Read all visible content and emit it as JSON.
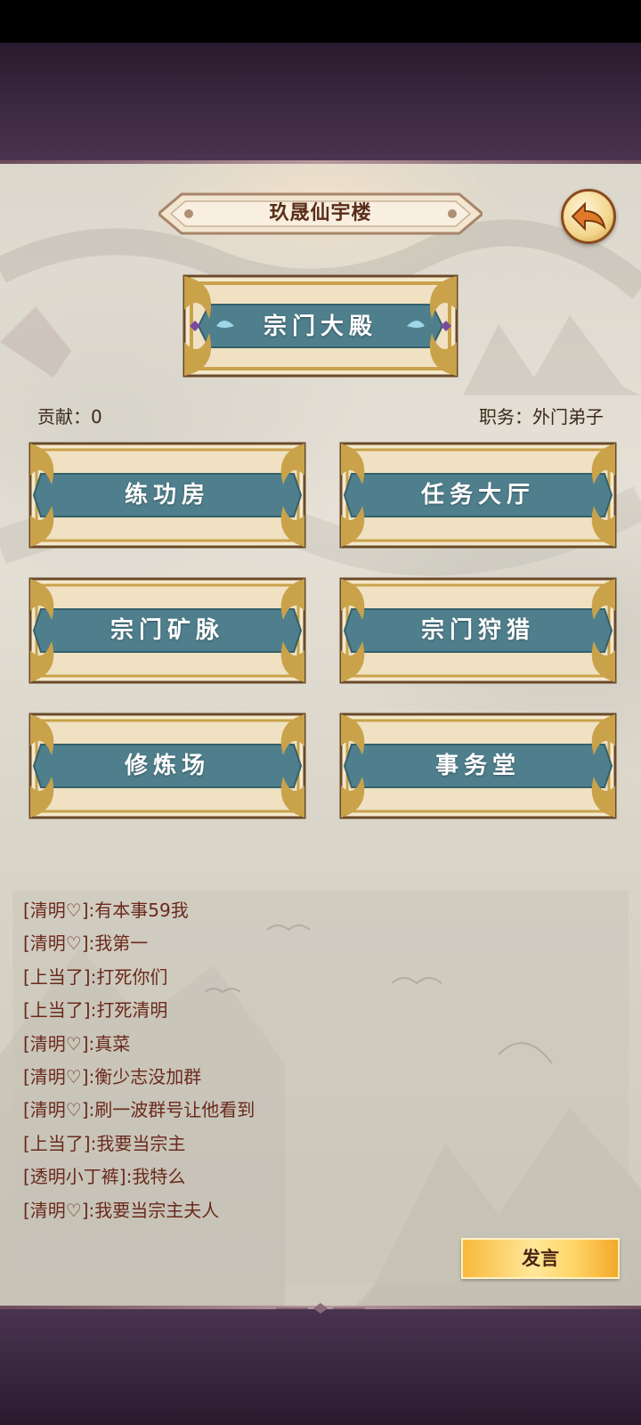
{
  "header": {
    "title": "玖晟仙宇楼",
    "back_icon": "back-arrow-icon"
  },
  "main_hall": {
    "label": "宗门大殿"
  },
  "status": {
    "contribution_label": "贡献：0",
    "position_label": "职务：外门弟子"
  },
  "buildings": [
    {
      "label": "练功房"
    },
    {
      "label": "任务大厅"
    },
    {
      "label": "宗门矿脉"
    },
    {
      "label": "宗门狩猎"
    },
    {
      "label": "修炼场"
    },
    {
      "label": "事务堂"
    }
  ],
  "chat": {
    "messages": [
      "[清明♡]:有本事59我",
      "[清明♡]:我第一",
      "[上当了]:打死你们",
      "[上当了]:打死清明",
      "[清明♡]:真菜",
      "[清明♡]:衡少志没加群",
      "[清明♡]:刷一波群号让他看到",
      "[上当了]:我要当宗主",
      "[透明小丁裤]:我特么",
      "[清明♡]:我要当宗主夫人"
    ],
    "send_label": "发言"
  },
  "colors": {
    "banner_blue": "#4f7f8c",
    "gold_frame": "#c9a24a",
    "text_brown": "#5a2e1a",
    "chat_text": "#6a2a1c"
  }
}
